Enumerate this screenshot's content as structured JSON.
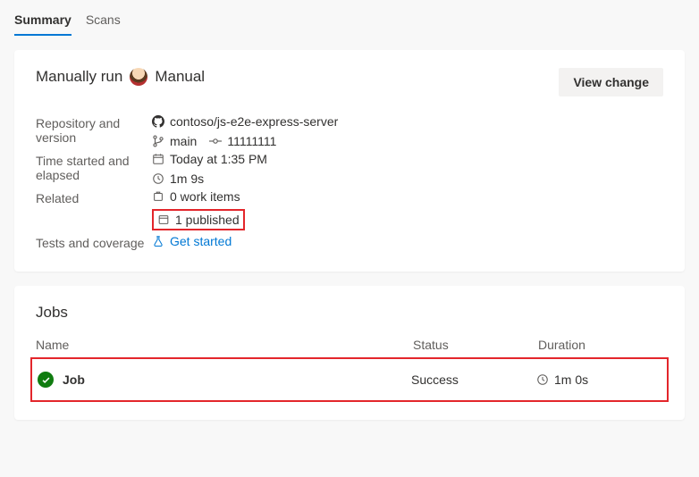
{
  "tabs": {
    "summary": "Summary",
    "scans": "Scans"
  },
  "run": {
    "title_prefix": "Manually run",
    "title_suffix": "Manual",
    "view_change": "View change",
    "labels": {
      "repo": "Repository and version",
      "time": "Time started and elapsed",
      "related": "Related",
      "tests": "Tests and coverage"
    },
    "repo_name": "contoso/js-e2e-express-server",
    "branch": "main",
    "commit": "11111111",
    "started": "Today at 1:35 PM",
    "elapsed": "1m 9s",
    "work_items": "0 work items",
    "published": "1 published",
    "get_started": "Get started"
  },
  "jobs": {
    "title": "Jobs",
    "columns": {
      "name": "Name",
      "status": "Status",
      "duration": "Duration"
    },
    "rows": [
      {
        "name": "Job",
        "status": "Success",
        "duration": "1m 0s"
      }
    ]
  }
}
